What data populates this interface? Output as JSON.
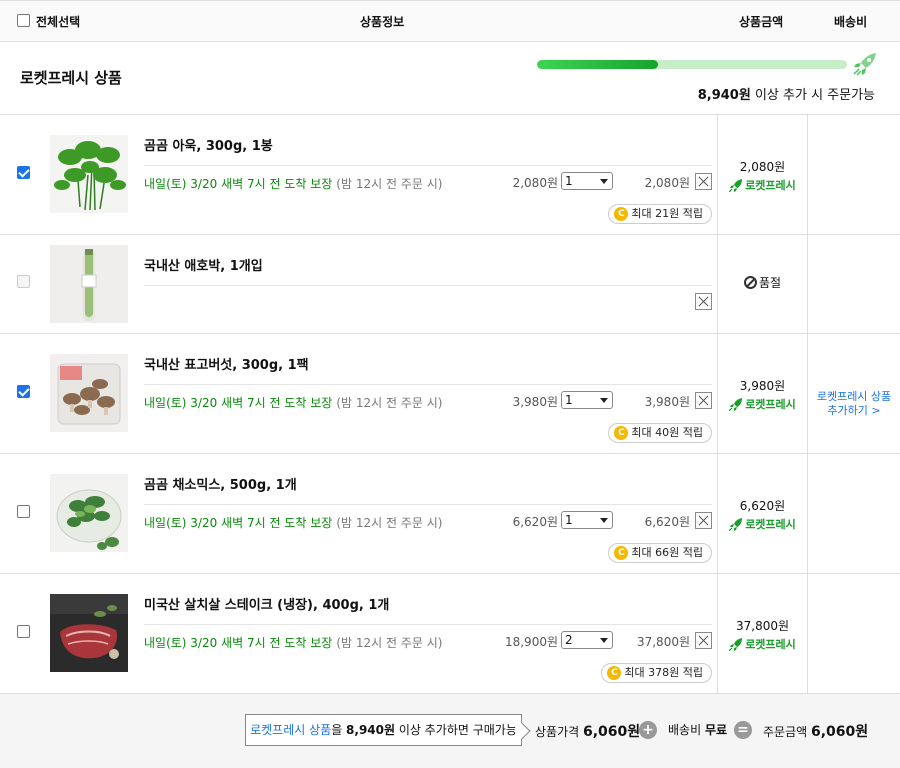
{
  "header": {
    "select_all": "전체선택",
    "product_info": "상품정보",
    "product_price": "상품금액",
    "shipping_fee": "배송비"
  },
  "section": {
    "title": "로켓프레시 상품",
    "progress": 0.39,
    "remaining_amount": "8,940원",
    "remaining_text": " 이상 추가 시 주문가능"
  },
  "items": [
    {
      "checked": true,
      "title": "곰곰 아욱, 300g, 1봉",
      "delivery": "내일(토) 3/20 새벽 7시 전 도착 보장",
      "delivery_sub": "(밤 12시 전 주문 시)",
      "unit_price": "2,080원",
      "quantity": "1",
      "line_total": "2,080원",
      "points": "최대 21원 적립",
      "price": "2,080원",
      "badge": "로켓프레시"
    },
    {
      "checked": false,
      "disabled": true,
      "title": "국내산 애호박, 1개입",
      "status": "품절"
    },
    {
      "checked": true,
      "title": "국내산 표고버섯, 300g, 1팩",
      "delivery": "내일(토) 3/20 새벽 7시 전 도착 보장",
      "delivery_sub": "(밤 12시 전 주문 시)",
      "unit_price": "3,980원",
      "quantity": "1",
      "line_total": "3,980원",
      "points": "최대 40원 적립",
      "price": "3,980원",
      "badge": "로켓프레시"
    },
    {
      "checked": false,
      "title": "곰곰 채소믹스, 500g, 1개",
      "delivery": "내일(토) 3/20 새벽 7시 전 도착 보장",
      "delivery_sub": "(밤 12시 전 주문 시)",
      "unit_price": "6,620원",
      "quantity": "1",
      "line_total": "6,620원",
      "points": "최대 66원 적립",
      "price": "6,620원",
      "badge": "로켓프레시"
    },
    {
      "checked": false,
      "title": "미국산 살치살 스테이크 (냉장), 400g, 1개",
      "delivery": "내일(토) 3/20 새벽 7시 전 도착 보장",
      "delivery_sub": "(밤 12시 전 주문 시)",
      "unit_price": "18,900원",
      "quantity": "2",
      "line_total": "37,800원",
      "points": "최대 378원 적립",
      "price": "37,800원",
      "badge": "로켓프레시"
    }
  ],
  "shipping": {
    "link": "로켓프레시 상품\n추가하기 >"
  },
  "footer": {
    "box_link": "로켓프레시 상품",
    "box_mid": "을 ",
    "box_amount": "8,940원",
    "box_rest": " 이상 추가하면 구매가능",
    "product_price_label": "상품가격 ",
    "product_price": "6,060원",
    "shipping_label": "배송비 ",
    "shipping_value": "무료",
    "order_label": "주문금액 ",
    "order_total": "6,060원",
    "plus": "+",
    "equals": "="
  },
  "colors": {
    "accent_blue": "#1a73e8",
    "rocket_green": "#1a9e2c",
    "delivery_green": "#0a8a0a",
    "progress_fill": "#16a32e",
    "coin": "#f5b800"
  }
}
